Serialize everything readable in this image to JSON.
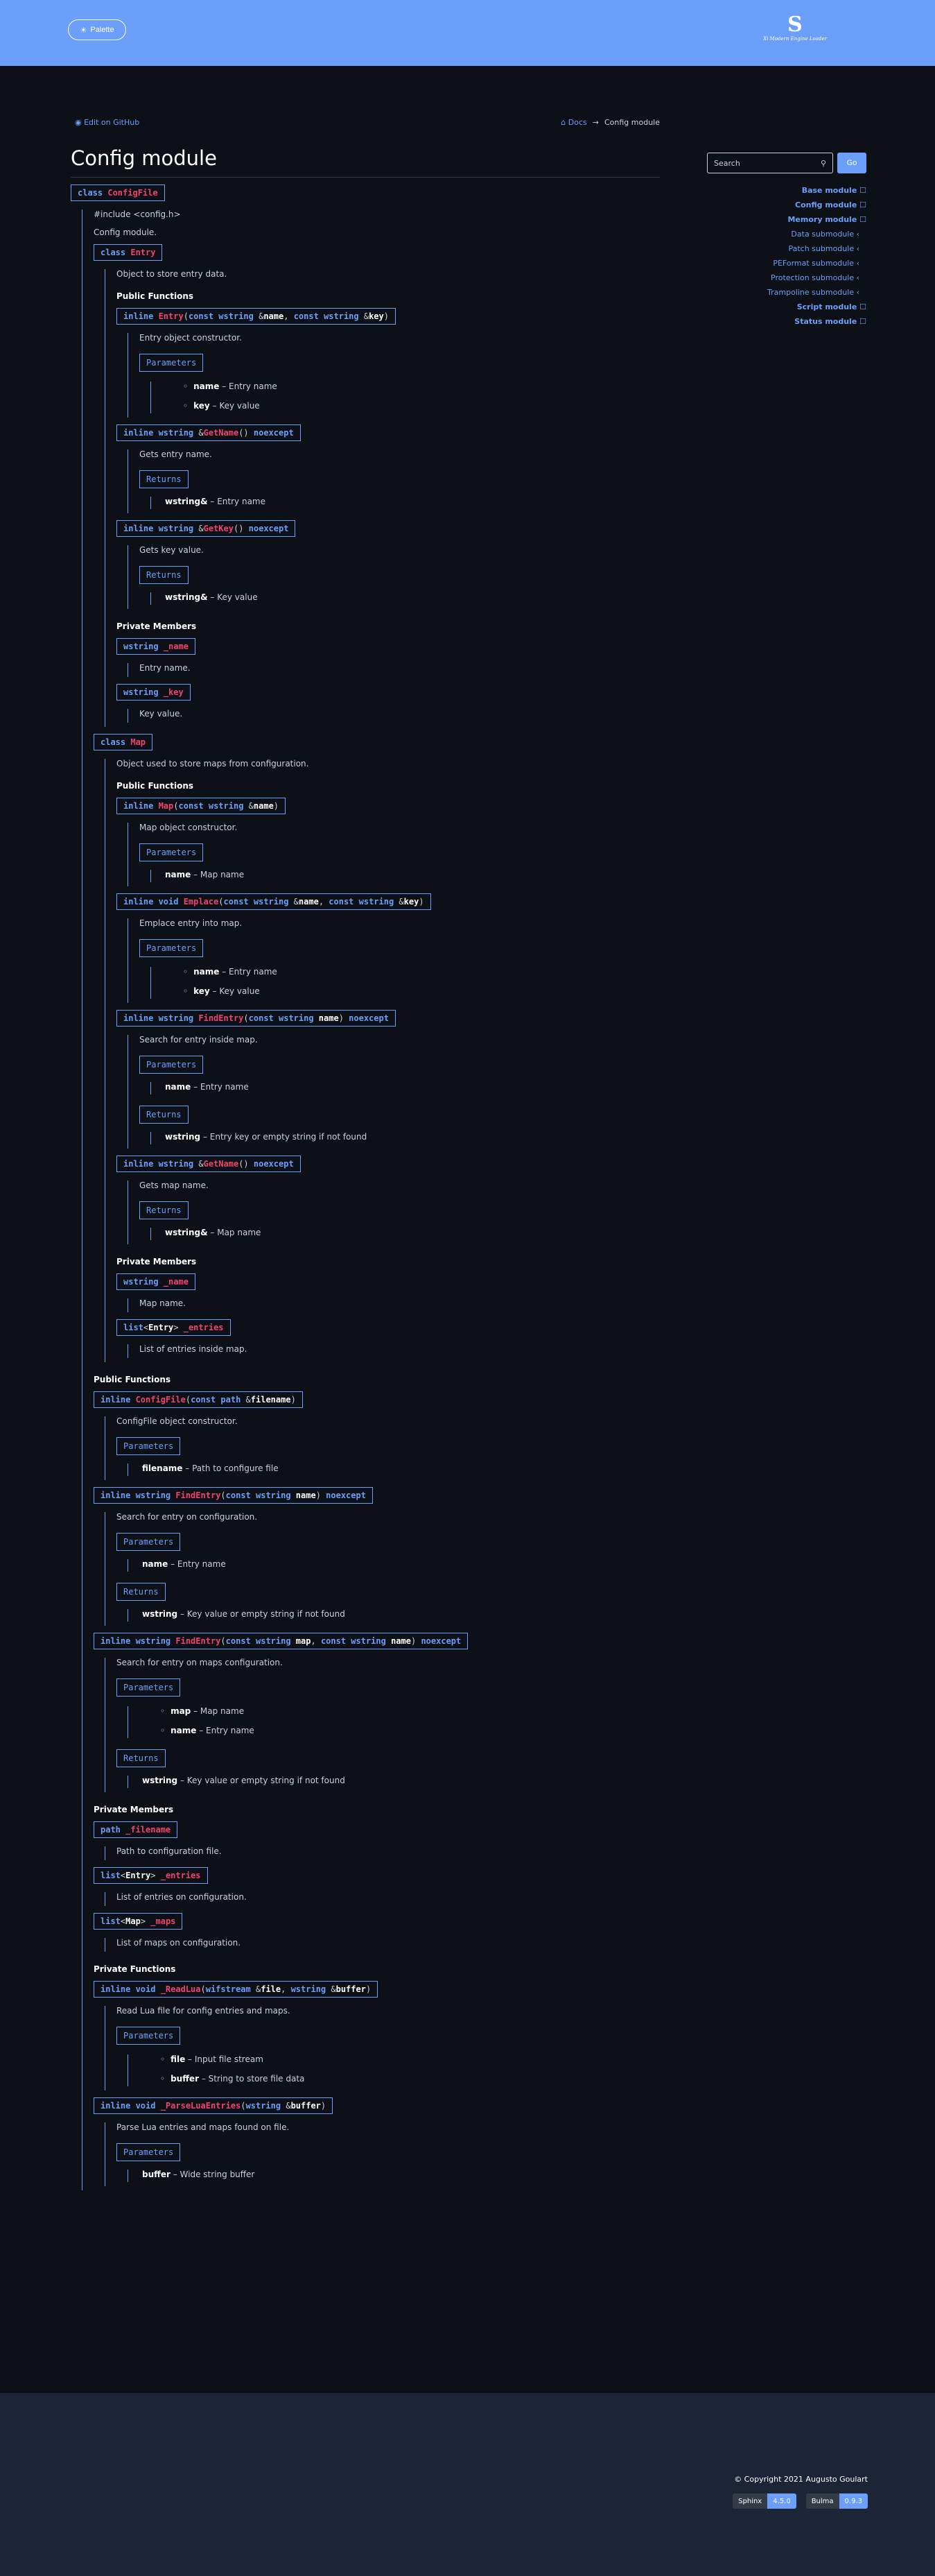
{
  "header": {
    "palette_label": "Palette",
    "logo_mark": "S",
    "logo_tag": "Xi Modern Engine Loader"
  },
  "meta": {
    "edit_label": "Edit on GitHub",
    "breadcrumb_home": "Docs",
    "breadcrumb_sep": "→",
    "breadcrumb_current": "Config module"
  },
  "page": {
    "title": "Config module"
  },
  "search": {
    "placeholder": "Search",
    "go": "Go"
  },
  "toc": [
    {
      "label": "Base module",
      "type": "m"
    },
    {
      "label": "Config module",
      "type": "m"
    },
    {
      "label": "Memory module",
      "type": "m"
    },
    {
      "label": "Data submodule",
      "type": "s"
    },
    {
      "label": "Patch submodule",
      "type": "s"
    },
    {
      "label": "PEFormat submodule",
      "type": "s"
    },
    {
      "label": "Protection submodule",
      "type": "s"
    },
    {
      "label": "Trampoline submodule",
      "type": "s"
    },
    {
      "label": "Script module",
      "type": "m"
    },
    {
      "label": "Status module",
      "type": "m"
    }
  ],
  "footer": {
    "copyright": "© Copyright 2021 Augusto Goulart",
    "b1a": "Sphinx",
    "b1b": "4.5.0",
    "b2a": "Bulma",
    "b2b": "0.9.3"
  },
  "doc": [
    {
      "t": "sig",
      "parts": [
        [
          "k",
          "class "
        ],
        [
          "n",
          "ConfigFile"
        ]
      ]
    },
    {
      "t": "open"
    },
    {
      "t": "txt",
      "v": "#include <config.h>"
    },
    {
      "t": "txt",
      "v": "Config module."
    },
    {
      "t": "sig",
      "parts": [
        [
          "k",
          "class "
        ],
        [
          "n",
          "Entry"
        ]
      ]
    },
    {
      "t": "open"
    },
    {
      "t": "txt",
      "v": "Object to store entry data."
    },
    {
      "t": "h",
      "v": "Public Functions"
    },
    {
      "t": "sig",
      "parts": [
        [
          "k",
          "inline "
        ],
        [
          "n",
          "Entry"
        ],
        [
          "p",
          "("
        ],
        [
          "k",
          "const wstring "
        ],
        [
          "p",
          "&"
        ],
        [
          "pn",
          "name"
        ],
        [
          "p",
          ", "
        ],
        [
          "k",
          "const wstring "
        ],
        [
          "p",
          "&"
        ],
        [
          "pn",
          "key"
        ],
        [
          "p",
          ")"
        ]
      ]
    },
    {
      "t": "open"
    },
    {
      "t": "txt",
      "v": "Entry object constructor."
    },
    {
      "t": "fl",
      "v": "Parameters"
    },
    {
      "t": "fopen"
    },
    {
      "t": "bl",
      "items": [
        [
          "name",
          "Entry name"
        ],
        [
          "key",
          "Key value"
        ]
      ]
    },
    {
      "t": "close"
    },
    {
      "t": "close"
    },
    {
      "t": "sig",
      "parts": [
        [
          "k",
          "inline wstring "
        ],
        [
          "p",
          "&"
        ],
        [
          "n",
          "GetName"
        ],
        [
          "p",
          "() "
        ],
        [
          "k",
          "noexcept"
        ]
      ]
    },
    {
      "t": "open"
    },
    {
      "t": "txt",
      "v": "Gets entry name."
    },
    {
      "t": "fl",
      "v": "Returns"
    },
    {
      "t": "fopen"
    },
    {
      "t": "pi",
      "b": "wstring&",
      "v": "Entry name"
    },
    {
      "t": "close"
    },
    {
      "t": "close"
    },
    {
      "t": "sig",
      "parts": [
        [
          "k",
          "inline wstring "
        ],
        [
          "p",
          "&"
        ],
        [
          "n",
          "GetKey"
        ],
        [
          "p",
          "() "
        ],
        [
          "k",
          "noexcept"
        ]
      ]
    },
    {
      "t": "open"
    },
    {
      "t": "txt",
      "v": "Gets key value."
    },
    {
      "t": "fl",
      "v": "Returns"
    },
    {
      "t": "fopen"
    },
    {
      "t": "pi",
      "b": "wstring&",
      "v": "Key value"
    },
    {
      "t": "close"
    },
    {
      "t": "close"
    },
    {
      "t": "h",
      "v": "Private Members"
    },
    {
      "t": "sig",
      "parts": [
        [
          "k",
          "wstring "
        ],
        [
          "n",
          "_name"
        ]
      ]
    },
    {
      "t": "open"
    },
    {
      "t": "txt",
      "v": "Entry name."
    },
    {
      "t": "close"
    },
    {
      "t": "sig",
      "parts": [
        [
          "k",
          "wstring "
        ],
        [
          "n",
          "_key"
        ]
      ]
    },
    {
      "t": "open"
    },
    {
      "t": "txt",
      "v": "Key value."
    },
    {
      "t": "close"
    },
    {
      "t": "close"
    },
    {
      "t": "sig",
      "parts": [
        [
          "k",
          "class "
        ],
        [
          "n",
          "Map"
        ]
      ]
    },
    {
      "t": "open"
    },
    {
      "t": "txt",
      "v": "Object used to store maps from configuration."
    },
    {
      "t": "h",
      "v": "Public Functions"
    },
    {
      "t": "sig",
      "parts": [
        [
          "k",
          "inline "
        ],
        [
          "n",
          "Map"
        ],
        [
          "p",
          "("
        ],
        [
          "k",
          "const wstring "
        ],
        [
          "p",
          "&"
        ],
        [
          "pn",
          "name"
        ],
        [
          "p",
          ")"
        ]
      ]
    },
    {
      "t": "open"
    },
    {
      "t": "txt",
      "v": "Map object constructor."
    },
    {
      "t": "fl",
      "v": "Parameters"
    },
    {
      "t": "fopen"
    },
    {
      "t": "pi",
      "b": "name",
      "v": "Map name"
    },
    {
      "t": "close"
    },
    {
      "t": "close"
    },
    {
      "t": "sig",
      "parts": [
        [
          "k",
          "inline void "
        ],
        [
          "n",
          "Emplace"
        ],
        [
          "p",
          "("
        ],
        [
          "k",
          "const wstring "
        ],
        [
          "p",
          "&"
        ],
        [
          "pn",
          "name"
        ],
        [
          "p",
          ", "
        ],
        [
          "k",
          "const wstring "
        ],
        [
          "p",
          "&"
        ],
        [
          "pn",
          "key"
        ],
        [
          "p",
          ")"
        ]
      ]
    },
    {
      "t": "open"
    },
    {
      "t": "txt",
      "v": "Emplace entry into map."
    },
    {
      "t": "fl",
      "v": "Parameters"
    },
    {
      "t": "fopen"
    },
    {
      "t": "bl",
      "items": [
        [
          "name",
          "Entry name"
        ],
        [
          "key",
          "Key value"
        ]
      ]
    },
    {
      "t": "close"
    },
    {
      "t": "close"
    },
    {
      "t": "sig",
      "parts": [
        [
          "k",
          "inline wstring "
        ],
        [
          "n",
          "FindEntry"
        ],
        [
          "p",
          "("
        ],
        [
          "k",
          "const wstring "
        ],
        [
          "pn",
          "name"
        ],
        [
          "p",
          ") "
        ],
        [
          "k",
          "noexcept"
        ]
      ]
    },
    {
      "t": "open"
    },
    {
      "t": "txt",
      "v": "Search for entry inside map."
    },
    {
      "t": "fl",
      "v": "Parameters"
    },
    {
      "t": "fopen"
    },
    {
      "t": "pi",
      "b": "name",
      "v": "Entry name"
    },
    {
      "t": "close"
    },
    {
      "t": "fl",
      "v": "Returns"
    },
    {
      "t": "fopen"
    },
    {
      "t": "pi",
      "b": "wstring",
      "v": "Entry key or empty string if not found"
    },
    {
      "t": "close"
    },
    {
      "t": "close"
    },
    {
      "t": "sig",
      "parts": [
        [
          "k",
          "inline wstring "
        ],
        [
          "p",
          "&"
        ],
        [
          "n",
          "GetName"
        ],
        [
          "p",
          "() "
        ],
        [
          "k",
          "noexcept"
        ]
      ]
    },
    {
      "t": "open"
    },
    {
      "t": "txt",
      "v": "Gets map name."
    },
    {
      "t": "fl",
      "v": "Returns"
    },
    {
      "t": "fopen"
    },
    {
      "t": "pi",
      "b": "wstring&",
      "v": "Map name"
    },
    {
      "t": "close"
    },
    {
      "t": "close"
    },
    {
      "t": "h",
      "v": "Private Members"
    },
    {
      "t": "sig",
      "parts": [
        [
          "k",
          "wstring "
        ],
        [
          "n",
          "_name"
        ]
      ]
    },
    {
      "t": "open"
    },
    {
      "t": "txt",
      "v": "Map name."
    },
    {
      "t": "close"
    },
    {
      "t": "sig",
      "parts": [
        [
          "k",
          "list"
        ],
        [
          "p",
          "<"
        ],
        [
          "pn",
          "Entry"
        ],
        [
          "p",
          "> "
        ],
        [
          "n",
          "_entries"
        ]
      ]
    },
    {
      "t": "open"
    },
    {
      "t": "txt",
      "v": "List of entries inside map."
    },
    {
      "t": "close"
    },
    {
      "t": "close"
    },
    {
      "t": "h",
      "v": "Public Functions"
    },
    {
      "t": "sig",
      "parts": [
        [
          "k",
          "inline "
        ],
        [
          "n",
          "ConfigFile"
        ],
        [
          "p",
          "("
        ],
        [
          "k",
          "const path "
        ],
        [
          "p",
          "&"
        ],
        [
          "pn",
          "filename"
        ],
        [
          "p",
          ")"
        ]
      ]
    },
    {
      "t": "open"
    },
    {
      "t": "txt",
      "v": "ConfigFile object constructor."
    },
    {
      "t": "fl",
      "v": "Parameters"
    },
    {
      "t": "fopen"
    },
    {
      "t": "pi",
      "b": "filename",
      "v": "Path to configure file"
    },
    {
      "t": "close"
    },
    {
      "t": "close"
    },
    {
      "t": "sig",
      "parts": [
        [
          "k",
          "inline wstring "
        ],
        [
          "n",
          "FindEntry"
        ],
        [
          "p",
          "("
        ],
        [
          "k",
          "const wstring "
        ],
        [
          "pn",
          "name"
        ],
        [
          "p",
          ") "
        ],
        [
          "k",
          "noexcept"
        ]
      ]
    },
    {
      "t": "open"
    },
    {
      "t": "txt",
      "v": "Search for entry on configuration."
    },
    {
      "t": "fl",
      "v": "Parameters"
    },
    {
      "t": "fopen"
    },
    {
      "t": "pi",
      "b": "name",
      "v": "Entry name"
    },
    {
      "t": "close"
    },
    {
      "t": "fl",
      "v": "Returns"
    },
    {
      "t": "fopen"
    },
    {
      "t": "pi",
      "b": "wstring",
      "v": "Key value or empty string if not found"
    },
    {
      "t": "close"
    },
    {
      "t": "close"
    },
    {
      "t": "sig",
      "parts": [
        [
          "k",
          "inline wstring "
        ],
        [
          "n",
          "FindEntry"
        ],
        [
          "p",
          "("
        ],
        [
          "k",
          "const wstring "
        ],
        [
          "pn",
          "map"
        ],
        [
          "p",
          ", "
        ],
        [
          "k",
          "const wstring "
        ],
        [
          "pn",
          "name"
        ],
        [
          "p",
          ") "
        ],
        [
          "k",
          "noexcept"
        ]
      ]
    },
    {
      "t": "open"
    },
    {
      "t": "txt",
      "v": "Search for entry on maps configuration."
    },
    {
      "t": "fl",
      "v": "Parameters"
    },
    {
      "t": "fopen"
    },
    {
      "t": "bl",
      "items": [
        [
          "map",
          "Map name"
        ],
        [
          "name",
          "Entry name"
        ]
      ]
    },
    {
      "t": "close"
    },
    {
      "t": "fl",
      "v": "Returns"
    },
    {
      "t": "fopen"
    },
    {
      "t": "pi",
      "b": "wstring",
      "v": "Key value or empty string if not found"
    },
    {
      "t": "close"
    },
    {
      "t": "close"
    },
    {
      "t": "h",
      "v": "Private Members"
    },
    {
      "t": "sig",
      "parts": [
        [
          "k",
          "path "
        ],
        [
          "n",
          "_filename"
        ]
      ]
    },
    {
      "t": "open"
    },
    {
      "t": "txt",
      "v": "Path to configuration file."
    },
    {
      "t": "close"
    },
    {
      "t": "sig",
      "parts": [
        [
          "k",
          "list"
        ],
        [
          "p",
          "<"
        ],
        [
          "pn",
          "Entry"
        ],
        [
          "p",
          "> "
        ],
        [
          "n",
          "_entries"
        ]
      ]
    },
    {
      "t": "open"
    },
    {
      "t": "txt",
      "v": "List of entries on configuration."
    },
    {
      "t": "close"
    },
    {
      "t": "sig",
      "parts": [
        [
          "k",
          "list"
        ],
        [
          "p",
          "<"
        ],
        [
          "pn",
          "Map"
        ],
        [
          "p",
          "> "
        ],
        [
          "n",
          "_maps"
        ]
      ]
    },
    {
      "t": "open"
    },
    {
      "t": "txt",
      "v": "List of maps on configuration."
    },
    {
      "t": "close"
    },
    {
      "t": "h",
      "v": "Private Functions"
    },
    {
      "t": "sig",
      "parts": [
        [
          "k",
          "inline void "
        ],
        [
          "n",
          "_ReadLua"
        ],
        [
          "p",
          "("
        ],
        [
          "k",
          "wifstream "
        ],
        [
          "p",
          "&"
        ],
        [
          "pn",
          "file"
        ],
        [
          "p",
          ", "
        ],
        [
          "k",
          "wstring "
        ],
        [
          "p",
          "&"
        ],
        [
          "pn",
          "buffer"
        ],
        [
          "p",
          ")"
        ]
      ]
    },
    {
      "t": "open"
    },
    {
      "t": "txt",
      "v": "Read Lua file for config entries and maps."
    },
    {
      "t": "fl",
      "v": "Parameters"
    },
    {
      "t": "fopen"
    },
    {
      "t": "bl",
      "items": [
        [
          "file",
          "Input file stream"
        ],
        [
          "buffer",
          "String to store file data"
        ]
      ]
    },
    {
      "t": "close"
    },
    {
      "t": "close"
    },
    {
      "t": "sig",
      "parts": [
        [
          "k",
          "inline void "
        ],
        [
          "n",
          "_ParseLuaEntries"
        ],
        [
          "p",
          "("
        ],
        [
          "k",
          "wstring "
        ],
        [
          "p",
          "&"
        ],
        [
          "pn",
          "buffer"
        ],
        [
          "p",
          ")"
        ]
      ]
    },
    {
      "t": "open"
    },
    {
      "t": "txt",
      "v": "Parse Lua entries and maps found on file."
    },
    {
      "t": "fl",
      "v": "Parameters"
    },
    {
      "t": "fopen"
    },
    {
      "t": "pi",
      "b": "buffer",
      "v": "Wide string buffer"
    },
    {
      "t": "close"
    },
    {
      "t": "close"
    },
    {
      "t": "close"
    }
  ]
}
